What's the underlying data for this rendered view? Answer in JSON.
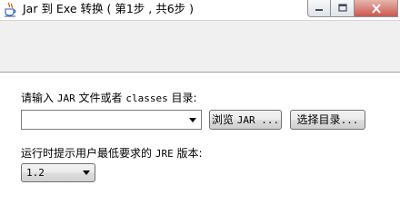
{
  "window": {
    "title": "Jar 到 Exe 转换 ( 第1步 , 共6步 )",
    "app_icon": "java-cup-icon"
  },
  "step": {
    "jar_prompt_prefix": "请输入 ",
    "jar_prompt_jar": "JAR",
    "jar_prompt_middle": " 文件或者 ",
    "jar_prompt_classes": "classes",
    "jar_prompt_suffix": " 目录:",
    "jar_path_value": "",
    "browse_jar_prefix": "浏览 ",
    "browse_jar_mono": "JAR ...",
    "select_dir_prefix": "选择目录",
    "select_dir_mono": "...",
    "jre_prompt_prefix": "运行时提示用户最低要求的 ",
    "jre_prompt_mono": "JRE",
    "jre_prompt_suffix": " 版本:",
    "jre_version_selected": "1.2"
  }
}
